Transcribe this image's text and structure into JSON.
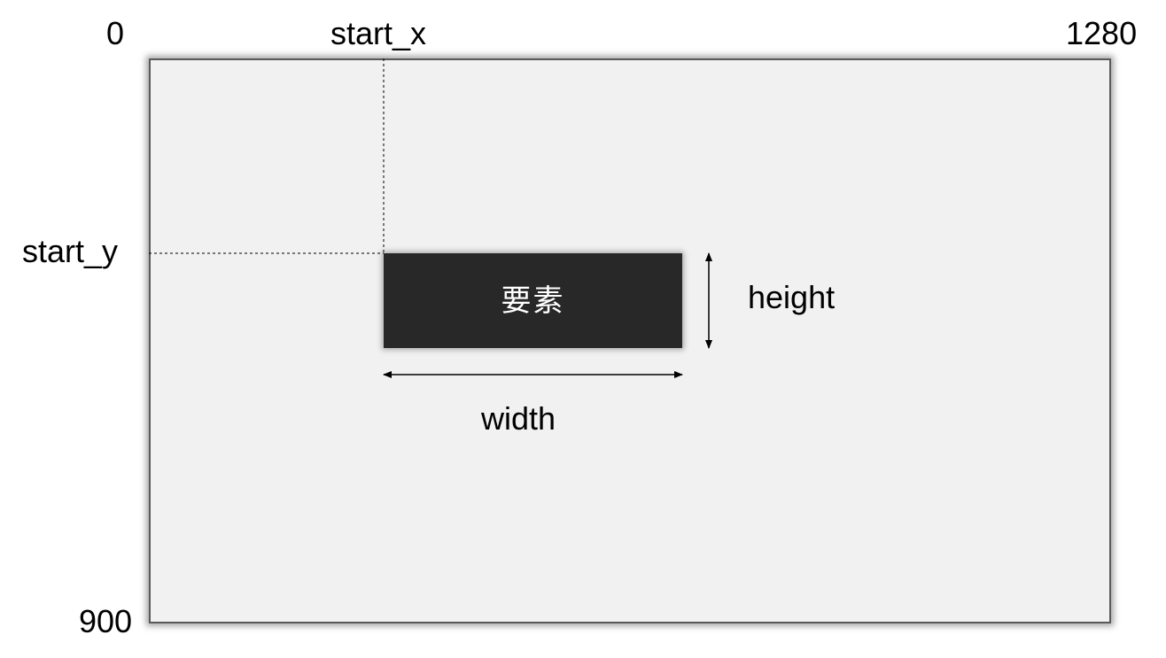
{
  "axis": {
    "origin_label": "0",
    "x_label": "start_x",
    "x_max_label": "1280",
    "y_label": "start_y",
    "y_max_label": "900"
  },
  "element": {
    "text": "要素"
  },
  "dimensions": {
    "width_label": "width",
    "height_label": "height"
  },
  "colors": {
    "screen_fill": "#f1f1f1",
    "screen_border": "#5a5a5a",
    "element_fill": "#282828",
    "element_text": "#ffffff",
    "guide_line": "#000000"
  }
}
